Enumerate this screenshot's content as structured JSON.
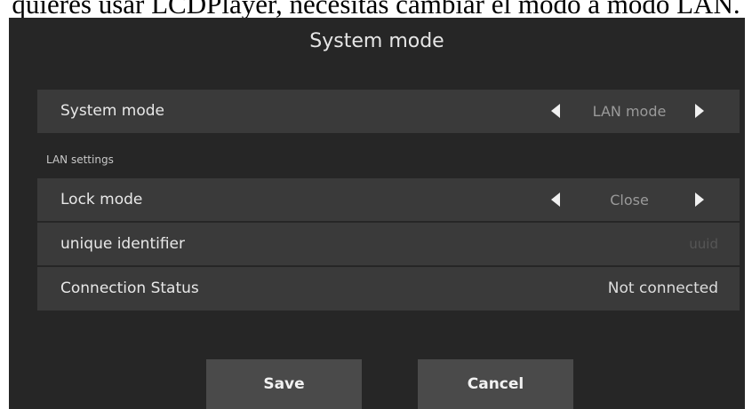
{
  "caption": "quieres usar LCDPlayer, necesitas cambiar el modo a modo LAN.",
  "dialog": {
    "title": "System mode",
    "system_mode_row": {
      "label": "System mode",
      "value": "LAN mode"
    },
    "lan_section": {
      "header": "LAN settings",
      "lock_mode": {
        "label": "Lock mode",
        "value": "Close"
      },
      "unique_identifier": {
        "label": "unique identifier",
        "placeholder": "uuid"
      },
      "connection_status": {
        "label": "Connection Status",
        "value": "Not connected"
      }
    },
    "buttons": {
      "save": "Save",
      "cancel": "Cancel"
    }
  },
  "colors": {
    "dialog_background": "#262626",
    "row_background": "#3a3a3a",
    "button_background": "#4a4a4a"
  },
  "icons": [
    "arrow-left-icon",
    "arrow-right-icon"
  ]
}
